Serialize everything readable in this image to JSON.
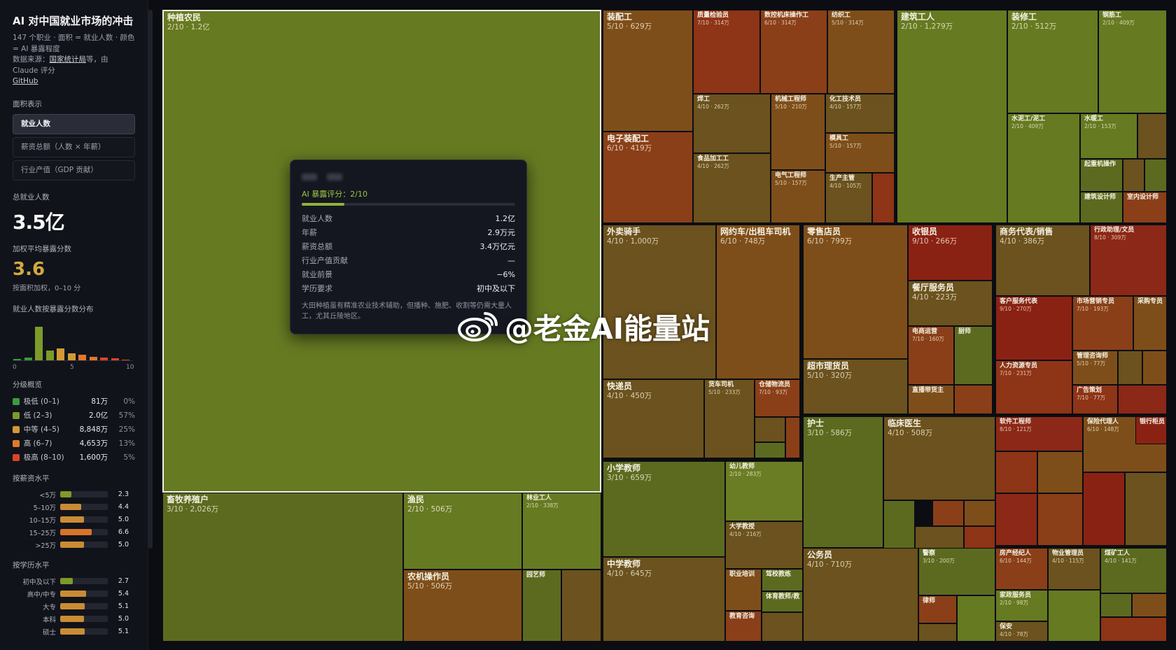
{
  "sidebar": {
    "title": "AI 对中国就业市场的冲击",
    "subtitle_1": "147 个职业 · 面积 = 就业人数 · 颜色 = AI 暴露程度",
    "source_prefix": "数据来源：",
    "source_link": "国家统计局",
    "source_suffix": "等，由 Claude 评分",
    "github": "GitHub",
    "area_label": "面积表示",
    "area_options": [
      "就业人数",
      "薪资总额（人数 × 年薪）",
      "行业产值（GDP 贡献）"
    ],
    "total_label": "总就业人数",
    "total_value": "3.5亿",
    "avg_label": "加权平均暴露分数",
    "avg_value": "3.6",
    "avg_note": "按面积加权，0–10 分",
    "hist_label": "就业人数按暴露分数分布",
    "hist_axis": [
      "0",
      "5",
      "10"
    ],
    "hist_values": [
      0.5,
      1.0,
      13.5,
      3.8,
      4.7,
      2.6,
      2.0,
      1.3,
      0.9,
      0.7,
      0.2
    ],
    "levels_label": "分级概览",
    "levels": [
      {
        "name": "极低 (0–1)",
        "count": "81万",
        "pct": "0%",
        "color": "#3c9a3c"
      },
      {
        "name": "低 (2–3)",
        "count": "2.0亿",
        "pct": "57%",
        "color": "#7d9a2a"
      },
      {
        "name": "中等 (4–5)",
        "count": "8,848万",
        "pct": "25%",
        "color": "#d19a34"
      },
      {
        "name": "高 (6–7)",
        "count": "4,653万",
        "pct": "13%",
        "color": "#e1782a"
      },
      {
        "name": "极高 (8–10)",
        "count": "1,600万",
        "pct": "5%",
        "color": "#d8442a"
      }
    ],
    "salary_label": "按薪资水平",
    "salary": [
      {
        "label": "<5万",
        "value": 2.3,
        "text": "2.3",
        "color": "#7d9a2a"
      },
      {
        "label": "5–10万",
        "value": 4.4,
        "text": "4.4",
        "color": "#c98c35"
      },
      {
        "label": "10–15万",
        "value": 5.0,
        "text": "5.0",
        "color": "#c98c35"
      },
      {
        "label": "15–25万",
        "value": 6.6,
        "text": "6.6",
        "color": "#d8742a"
      },
      {
        "label": ">25万",
        "value": 5.0,
        "text": "5.0",
        "color": "#c98c35"
      }
    ],
    "edu_label": "按学历水平",
    "edu": [
      {
        "label": "初中及以下",
        "value": 2.7,
        "text": "2.7",
        "color": "#7d9a2a"
      },
      {
        "label": "高中/中专",
        "value": 5.4,
        "text": "5.4",
        "color": "#c98c35"
      },
      {
        "label": "大专",
        "value": 5.1,
        "text": "5.1",
        "color": "#c98c35"
      },
      {
        "label": "本科",
        "value": 5.0,
        "text": "5.0",
        "color": "#c98c35"
      },
      {
        "label": "硕士",
        "value": 5.1,
        "text": "5.1",
        "color": "#c98c35"
      }
    ]
  },
  "tooltip": {
    "score_label": "AI 暴露评分：2/10",
    "score_value": 2,
    "rows": [
      {
        "k": "就业人数",
        "v": "1.2亿"
      },
      {
        "k": "年薪",
        "v": "2.9万元"
      },
      {
        "k": "薪资总额",
        "v": "3.4万亿元"
      },
      {
        "k": "行业产值贡献",
        "v": "—"
      },
      {
        "k": "就业前景",
        "v": "−6%"
      },
      {
        "k": "学历要求",
        "v": "初中及以下"
      }
    ],
    "desc": "大田种植虽有精准农业技术辅助，但播种、施肥、收割等仍需大量人工，尤其丘陵地区。"
  },
  "watermark": "@老金AI能量站",
  "colors": {
    "s1": "#6a7d24",
    "s2": "#667a22",
    "s3": "#5c6a20",
    "s4": "#6b521e",
    "s5": "#7e4e1a",
    "s6": "#8a3f19",
    "s7": "#8e3417",
    "s8": "#8c2817",
    "s9": "#8a2214"
  },
  "tiles": [
    {
      "name": "种植农民",
      "sub": "2/10 · 1.2亿",
      "s": 2,
      "big": true,
      "sel": true
    },
    {
      "name": "畜牧养殖户",
      "sub": "3/10 · 2,026万",
      "s": 3,
      "big": true
    },
    {
      "name": "渔民",
      "sub": "2/10 · 506万",
      "s": 2,
      "big": true
    },
    {
      "name": "农机操作员",
      "sub": "5/10 · 506万",
      "s": 5,
      "big": true
    },
    {
      "name": "林业工人",
      "sub": "2/10 · 338万",
      "s": 2
    },
    {
      "name": "园艺师",
      "sub": "",
      "s": 3
    },
    {
      "name": "",
      "sub": "",
      "s": 4
    },
    {
      "name": "装配工",
      "sub": "5/10 · 629万",
      "s": 5,
      "big": true
    },
    {
      "name": "质量检验员",
      "sub": "7/10 · 314万",
      "s": 7
    },
    {
      "name": "数控机床操作工",
      "sub": "6/10 · 314万",
      "s": 6
    },
    {
      "name": "纺织工",
      "sub": "5/10 · 314万",
      "s": 5
    },
    {
      "name": "电子装配工",
      "sub": "6/10 · 419万",
      "s": 6,
      "big": true
    },
    {
      "name": "焊工",
      "sub": "4/10 · 262万",
      "s": 4
    },
    {
      "name": "机械工程师",
      "sub": "5/10 · 210万",
      "s": 5
    },
    {
      "name": "化工技术员",
      "sub": "4/10 · 157万",
      "s": 4
    },
    {
      "name": "模具工",
      "sub": "5/10 · 157万",
      "s": 5
    },
    {
      "name": "食品加工工",
      "sub": "4/10 · 262万",
      "s": 4
    },
    {
      "name": "电气工程师",
      "sub": "5/10 · 157万",
      "s": 5
    },
    {
      "name": "生产主管",
      "sub": "4/10 · 105万",
      "s": 4
    },
    {
      "name": "",
      "sub": "",
      "s": 7
    },
    {
      "name": "建筑工人",
      "sub": "2/10 · 1,279万",
      "s": 2,
      "big": true
    },
    {
      "name": "装修工",
      "sub": "2/10 · 512万",
      "s": 2,
      "big": true
    },
    {
      "name": "钢筋工",
      "sub": "2/10 · 409万",
      "s": 2
    },
    {
      "name": "水泥工/泥工",
      "sub": "2/10 · 409万",
      "s": 2
    },
    {
      "name": "水暖工",
      "sub": "2/10 · 153万",
      "s": 2
    },
    {
      "name": "",
      "sub": "",
      "s": 4
    },
    {
      "name": "起重机操作",
      "sub": "",
      "s": 3
    },
    {
      "name": "",
      "sub": "",
      "s": 4
    },
    {
      "name": "",
      "sub": "",
      "s": 3
    },
    {
      "name": "建筑设计师",
      "sub": "",
      "s": 3
    },
    {
      "name": "室内设计师",
      "sub": "",
      "s": 6
    },
    {
      "name": "外卖骑手",
      "sub": "4/10 · 1,000万",
      "s": 4,
      "big": true
    },
    {
      "name": "网约车/出租车司机",
      "sub": "6/10 · 748万",
      "s": 5,
      "big": true
    },
    {
      "name": "快递员",
      "sub": "4/10 · 450万",
      "s": 4,
      "big": true
    },
    {
      "name": "货车司机",
      "sub": "5/10 · 233万",
      "s": 4
    },
    {
      "name": "仓储物流员",
      "sub": "7/10 · 93万",
      "s": 6
    },
    {
      "name": "",
      "sub": "",
      "s": 4
    },
    {
      "name": "",
      "sub": "",
      "s": 3
    },
    {
      "name": "",
      "sub": "",
      "s": 6
    },
    {
      "name": "零售店员",
      "sub": "6/10 · 799万",
      "s": 5,
      "big": true
    },
    {
      "name": "收银员",
      "sub": "9/10 · 266万",
      "s": 9,
      "big": true
    },
    {
      "name": "餐厅服务员",
      "sub": "4/10 · 223万",
      "s": 4,
      "big": true
    },
    {
      "name": "超市理货员",
      "sub": "5/10 · 320万",
      "s": 4,
      "big": true
    },
    {
      "name": "电商运营",
      "sub": "7/10 · 160万",
      "s": 6
    },
    {
      "name": "厨师",
      "sub": "",
      "s": 3
    },
    {
      "name": "直播带货主",
      "sub": "",
      "s": 5
    },
    {
      "name": "",
      "sub": "",
      "s": 6
    },
    {
      "name": "",
      "sub": "",
      "s": 4
    },
    {
      "name": "商务代表/销售",
      "sub": "4/10 · 386万",
      "s": 4,
      "big": true
    },
    {
      "name": "行政助理/文员",
      "sub": "8/10 · 309万",
      "s": 8
    },
    {
      "name": "客户服务代表",
      "sub": "9/10 · 270万",
      "s": 9
    },
    {
      "name": "市场营销专员",
      "sub": "7/10 · 193万",
      "s": 6
    },
    {
      "name": "采购专员",
      "sub": "",
      "s": 5
    },
    {
      "name": "人力资源专员",
      "sub": "7/10 · 231万",
      "s": 7
    },
    {
      "name": "管理咨询师",
      "sub": "5/10 · 77万",
      "s": 5
    },
    {
      "name": "广告策划",
      "sub": "7/10 · 77万",
      "s": 7
    },
    {
      "name": "",
      "sub": "",
      "s": 4
    },
    {
      "name": "",
      "sub": "",
      "s": 5
    },
    {
      "name": "",
      "sub": "",
      "s": 8
    },
    {
      "name": "小学教师",
      "sub": "3/10 · 659万",
      "s": 3,
      "big": true
    },
    {
      "name": "幼儿教师",
      "sub": "2/10 · 283万",
      "s": 1
    },
    {
      "name": "中学教师",
      "sub": "4/10 · 645万",
      "s": 4,
      "big": true
    },
    {
      "name": "大学教授",
      "sub": "4/10 · 216万",
      "s": 4
    },
    {
      "name": "职业培训",
      "sub": "",
      "s": 5
    },
    {
      "name": "驾校教练",
      "sub": "",
      "s": 3
    },
    {
      "name": "体育教师/教",
      "sub": "",
      "s": 3
    },
    {
      "name": "教育咨询",
      "sub": "",
      "s": 6
    },
    {
      "name": "",
      "sub": "",
      "s": 4
    },
    {
      "name": "护士",
      "sub": "3/10 · 586万",
      "s": 3,
      "big": true
    },
    {
      "name": "临床医生",
      "sub": "4/10 · 508万",
      "s": 4,
      "big": true
    },
    {
      "name": "",
      "sub": "",
      "s": 2
    },
    {
      "name": "",
      "sub": "",
      "s": 6
    },
    {
      "name": "",
      "sub": "",
      "s": 3
    },
    {
      "name": "",
      "sub": "",
      "s": 5
    },
    {
      "name": "",
      "sub": "",
      "s": 4
    },
    {
      "name": "",
      "sub": "",
      "s": 7
    },
    {
      "name": "软件工程师",
      "sub": "8/10 · 121万",
      "s": 8
    },
    {
      "name": "保险代理人",
      "sub": "6/10 · 148万",
      "s": 5
    },
    {
      "name": "银行柜员",
      "sub": "",
      "s": 9
    },
    {
      "name": "",
      "sub": "",
      "s": 7
    },
    {
      "name": "",
      "sub": "",
      "s": 5
    },
    {
      "name": "",
      "sub": "",
      "s": 8
    },
    {
      "name": "",
      "sub": "",
      "s": 6
    },
    {
      "name": "",
      "sub": "",
      "s": 9
    },
    {
      "name": "",
      "sub": "",
      "s": 4
    },
    {
      "name": "公务员",
      "sub": "4/10 · 710万",
      "s": 4,
      "big": true
    },
    {
      "name": "警察",
      "sub": "3/10 · 200万",
      "s": 3
    },
    {
      "name": "律师",
      "sub": "",
      "s": 6
    },
    {
      "name": "",
      "sub": "",
      "s": 4
    },
    {
      "name": "",
      "sub": "",
      "s": 2
    },
    {
      "name": "房产经纪人",
      "sub": "6/10 · 144万",
      "s": 6
    },
    {
      "name": "物业管理员",
      "sub": "4/10 · 115万",
      "s": 4
    },
    {
      "name": "煤矿工人",
      "sub": "4/10 · 141万",
      "s": 3
    },
    {
      "name": "家政服务员",
      "sub": "2/10 · 98万",
      "s": 2
    },
    {
      "name": "保安",
      "sub": "4/10 · 78万",
      "s": 4
    },
    {
      "name": "",
      "sub": "",
      "s": 2
    },
    {
      "name": "",
      "sub": "",
      "s": 3
    },
    {
      "name": "",
      "sub": "",
      "s": 5
    },
    {
      "name": "",
      "sub": "",
      "s": 7
    },
    {
      "name": "",
      "sub": "",
      "s": 4
    }
  ]
}
